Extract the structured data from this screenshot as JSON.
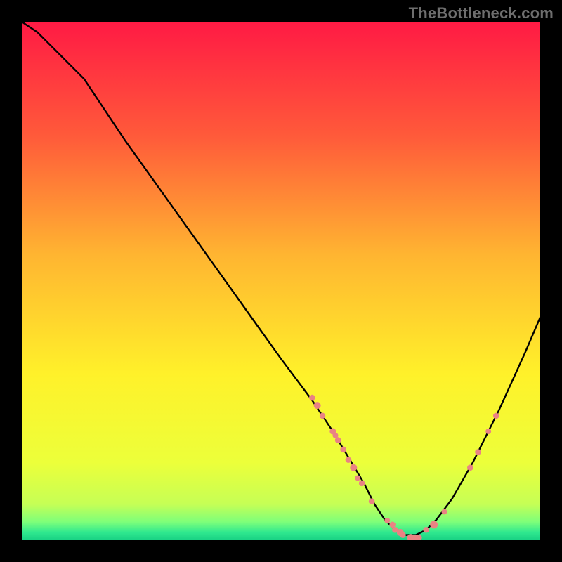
{
  "watermark": "TheBottleneck.com",
  "colors": {
    "curve": "#000000",
    "marker_fill": "#e98383",
    "marker_stroke": "#bd4747"
  },
  "gradient_stops": [
    {
      "offset": 0.0,
      "color": "#ff1a44"
    },
    {
      "offset": 0.22,
      "color": "#ff5a3a"
    },
    {
      "offset": 0.45,
      "color": "#ffb531"
    },
    {
      "offset": 0.68,
      "color": "#fff12a"
    },
    {
      "offset": 0.85,
      "color": "#ecff3a"
    },
    {
      "offset": 0.93,
      "color": "#c6ff55"
    },
    {
      "offset": 0.965,
      "color": "#7dff7a"
    },
    {
      "offset": 0.985,
      "color": "#2fe88f"
    },
    {
      "offset": 1.0,
      "color": "#18d184"
    }
  ],
  "chart_data": {
    "type": "line",
    "title": "",
    "xlabel": "",
    "ylabel": "",
    "xlim": [
      0,
      100
    ],
    "ylim": [
      0,
      100
    ],
    "curve": {
      "x": [
        0,
        3,
        7,
        12,
        20,
        30,
        40,
        50,
        56,
        60,
        63,
        66,
        68,
        70,
        72,
        74,
        76,
        78,
        80,
        83,
        87,
        92,
        97,
        100
      ],
      "y": [
        100,
        98,
        94,
        89,
        77,
        63,
        49,
        35,
        27,
        21,
        16,
        11,
        7,
        4,
        2,
        1,
        1,
        2,
        4,
        8,
        15,
        25,
        36,
        43
      ]
    },
    "markers": [
      {
        "x": 56.0,
        "y": 27.5,
        "r": 4.3
      },
      {
        "x": 57.0,
        "y": 26.0,
        "r": 5.0
      },
      {
        "x": 58.0,
        "y": 24.0,
        "r": 4.2
      },
      {
        "x": 60.0,
        "y": 21.0,
        "r": 4.5
      },
      {
        "x": 60.5,
        "y": 20.2,
        "r": 4.0
      },
      {
        "x": 61.0,
        "y": 19.3,
        "r": 4.3
      },
      {
        "x": 62.0,
        "y": 17.5,
        "r": 4.3
      },
      {
        "x": 63.0,
        "y": 15.5,
        "r": 4.3
      },
      {
        "x": 64.0,
        "y": 14.0,
        "r": 5.0
      },
      {
        "x": 64.8,
        "y": 12.0,
        "r": 4.0
      },
      {
        "x": 65.6,
        "y": 11.0,
        "r": 4.3
      },
      {
        "x": 67.5,
        "y": 7.5,
        "r": 4.3
      },
      {
        "x": 70.5,
        "y": 3.8,
        "r": 4.0
      },
      {
        "x": 71.5,
        "y": 3.0,
        "r": 4.3
      },
      {
        "x": 72.0,
        "y": 2.0,
        "r": 4.3
      },
      {
        "x": 73.0,
        "y": 1.5,
        "r": 5.0
      },
      {
        "x": 73.5,
        "y": 1.0,
        "r": 4.3
      },
      {
        "x": 75.0,
        "y": 0.5,
        "r": 5.0
      },
      {
        "x": 75.8,
        "y": 0.5,
        "r": 4.3
      },
      {
        "x": 76.6,
        "y": 0.5,
        "r": 4.3
      },
      {
        "x": 78.0,
        "y": 2.0,
        "r": 4.3
      },
      {
        "x": 79.5,
        "y": 3.0,
        "r": 5.5
      },
      {
        "x": 81.5,
        "y": 5.5,
        "r": 4.0
      },
      {
        "x": 86.5,
        "y": 14.0,
        "r": 4.3
      },
      {
        "x": 88.0,
        "y": 17.0,
        "r": 4.3
      },
      {
        "x": 90.0,
        "y": 21.0,
        "r": 4.0
      },
      {
        "x": 91.5,
        "y": 24.0,
        "r": 4.3
      }
    ]
  }
}
